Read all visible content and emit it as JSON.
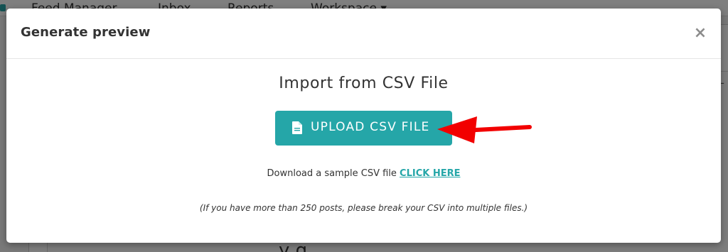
{
  "background": {
    "nav_items": [
      "Feed Manager",
      "Inbox",
      "Reports",
      "Workspace ▾"
    ],
    "bottom_text": "y      g  ",
    "right_caret": "–"
  },
  "modal": {
    "title": "Generate preview",
    "close_icon": "×",
    "import_title": "Import from CSV File",
    "upload_button_label": "UPLOAD CSV FILE",
    "upload_icon": "file-icon",
    "download_text": "Download a sample CSV file",
    "download_link_label": "CLICK HERE",
    "note": "(If you have more than 250 posts, please break your CSV into multiple files.)"
  },
  "annotation": {
    "arrow_color": "#f20000",
    "arrow_icon": "red-arrow-pointer-icon"
  },
  "colors": {
    "accent": "#25a6a8",
    "text": "#333333",
    "close": "#8c8c8c"
  }
}
